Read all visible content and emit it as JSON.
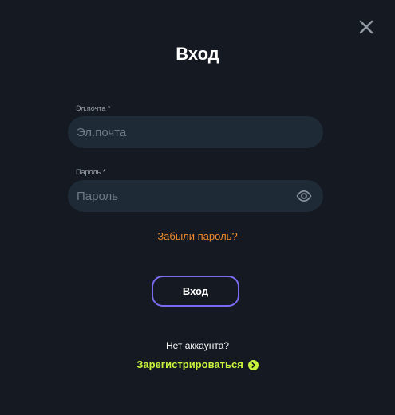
{
  "modal": {
    "title": "Вход",
    "close_icon": "close-icon"
  },
  "email": {
    "label": "Эл.почта *",
    "placeholder": "Эл.почта",
    "value": ""
  },
  "password": {
    "label": "Пароль *",
    "placeholder": "Пароль",
    "value": "",
    "toggle_icon": "eye-icon"
  },
  "forgot_password": {
    "label": "Забыли пароль?"
  },
  "login_button": {
    "label": "Вход"
  },
  "register": {
    "prompt": "Нет аккаунта?",
    "label": "Зарегистрироваться",
    "icon": "chevron-right-circle-icon"
  },
  "colors": {
    "background": "#141922",
    "input_background": "#1e2b36",
    "accent_border": "#7b6af0",
    "link_orange": "#f08a2c",
    "register_green": "#c8f53c"
  }
}
